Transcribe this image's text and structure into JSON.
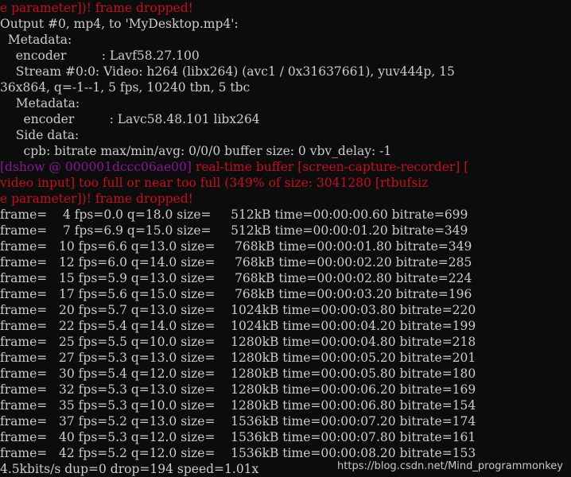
{
  "colors": {
    "background": "#0c0c0c",
    "normal": "#cccccc",
    "error_red": "#c50f1f",
    "tag_purple": "#881798"
  },
  "terminal": {
    "lines": [
      [
        {
          "t": "e parameter])! frame dropped!",
          "c": "red"
        }
      ],
      [
        {
          "t": "Output #0, mp4, to 'MyDesktop.mp4':",
          "c": "normal"
        }
      ],
      [
        {
          "t": "  Metadata:",
          "c": "normal"
        }
      ],
      [
        {
          "t": "    encoder         : Lavf58.27.100",
          "c": "normal"
        }
      ],
      [
        {
          "t": "    Stream #0:0: Video: h264 (libx264) (avc1 / 0x31637661), yuv444p, 15",
          "c": "normal"
        }
      ],
      [
        {
          "t": "36x864, q=-1--1, 5 fps, 10240 tbn, 5 tbc",
          "c": "normal"
        }
      ],
      [
        {
          "t": "    Metadata:",
          "c": "normal"
        }
      ],
      [
        {
          "t": "      encoder         : Lavc58.48.101 libx264",
          "c": "normal"
        }
      ],
      [
        {
          "t": "    Side data:",
          "c": "normal"
        }
      ],
      [
        {
          "t": "      cpb: bitrate max/min/avg: 0/0/0 buffer size: 0 vbv_delay: -1",
          "c": "normal"
        }
      ],
      [
        {
          "t": "[dshow @ 000001dccc06ae00]",
          "c": "purple"
        },
        {
          "t": " real-time buffer [screen-capture-recorder] [",
          "c": "red"
        }
      ],
      [
        {
          "t": "video input] too full or near too full (349% of size: 3041280 [rtbufsiz",
          "c": "red"
        }
      ],
      [
        {
          "t": "e parameter])! frame dropped!",
          "c": "red"
        }
      ],
      [
        {
          "t": "frame=    4 fps=0.0 q=18.0 size=     512kB time=00:00:00.60 bitrate=699",
          "c": "normal"
        }
      ],
      [
        {
          "t": "frame=    7 fps=6.9 q=15.0 size=     512kB time=00:00:01.20 bitrate=349",
          "c": "normal"
        }
      ],
      [
        {
          "t": "frame=   10 fps=6.6 q=13.0 size=     768kB time=00:00:01.80 bitrate=349",
          "c": "normal"
        }
      ],
      [
        {
          "t": "frame=   12 fps=6.0 q=14.0 size=     768kB time=00:00:02.20 bitrate=285",
          "c": "normal"
        }
      ],
      [
        {
          "t": "frame=   15 fps=5.9 q=13.0 size=     768kB time=00:00:02.80 bitrate=224",
          "c": "normal"
        }
      ],
      [
        {
          "t": "frame=   17 fps=5.6 q=15.0 size=     768kB time=00:00:03.20 bitrate=196",
          "c": "normal"
        }
      ],
      [
        {
          "t": "frame=   20 fps=5.7 q=13.0 size=    1024kB time=00:00:03.80 bitrate=220",
          "c": "normal"
        }
      ],
      [
        {
          "t": "frame=   22 fps=5.4 q=14.0 size=    1024kB time=00:00:04.20 bitrate=199",
          "c": "normal"
        }
      ],
      [
        {
          "t": "frame=   25 fps=5.5 q=10.0 size=    1280kB time=00:00:04.80 bitrate=218",
          "c": "normal"
        }
      ],
      [
        {
          "t": "frame=   27 fps=5.3 q=13.0 size=    1280kB time=00:00:05.20 bitrate=201",
          "c": "normal"
        }
      ],
      [
        {
          "t": "frame=   30 fps=5.4 q=12.0 size=    1280kB time=00:00:05.80 bitrate=180",
          "c": "normal"
        }
      ],
      [
        {
          "t": "frame=   32 fps=5.3 q=13.0 size=    1280kB time=00:00:06.20 bitrate=169",
          "c": "normal"
        }
      ],
      [
        {
          "t": "frame=   35 fps=5.3 q=10.0 size=    1280kB time=00:00:06.80 bitrate=154",
          "c": "normal"
        }
      ],
      [
        {
          "t": "frame=   37 fps=5.2 q=13.0 size=    1536kB time=00:00:07.20 bitrate=174",
          "c": "normal"
        }
      ],
      [
        {
          "t": "frame=   40 fps=5.3 q=12.0 size=    1536kB time=00:00:07.80 bitrate=161",
          "c": "normal"
        }
      ],
      [
        {
          "t": "frame=   42 fps=5.2 q=12.0 size=    1536kB time=00:00:08.20 bitrate=153",
          "c": "normal"
        }
      ],
      [
        {
          "t": "4.5kbits/s dup=0 drop=194 speed=1.01x",
          "c": "normal"
        }
      ]
    ]
  },
  "watermark": "https://blog.csdn.net/Mind_programmonkey"
}
